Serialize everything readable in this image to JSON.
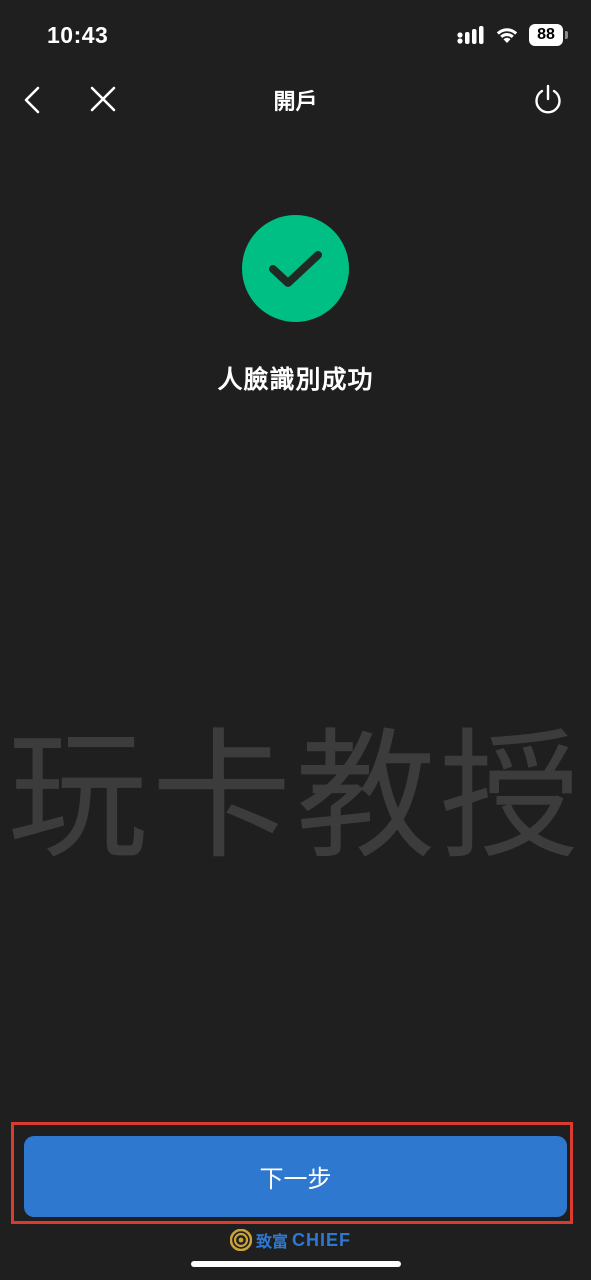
{
  "status_bar": {
    "time": "10:43",
    "battery": "88",
    "icons": [
      "cellular-signal-icon",
      "wifi-icon",
      "battery-icon"
    ]
  },
  "nav": {
    "title": "開戶",
    "icons": [
      "chevron-left-icon",
      "close-icon",
      "power-icon"
    ]
  },
  "main": {
    "status_icon": "check-circle-icon",
    "status_color": "#00bf85",
    "message": "人臉識別成功",
    "watermark": "玩卡教授"
  },
  "footer": {
    "next_label": "下一步",
    "button_color": "#2f78d0",
    "highlight_color": "#d93b2e",
    "brand_zh": "致富",
    "brand_en": "CHIEF"
  }
}
